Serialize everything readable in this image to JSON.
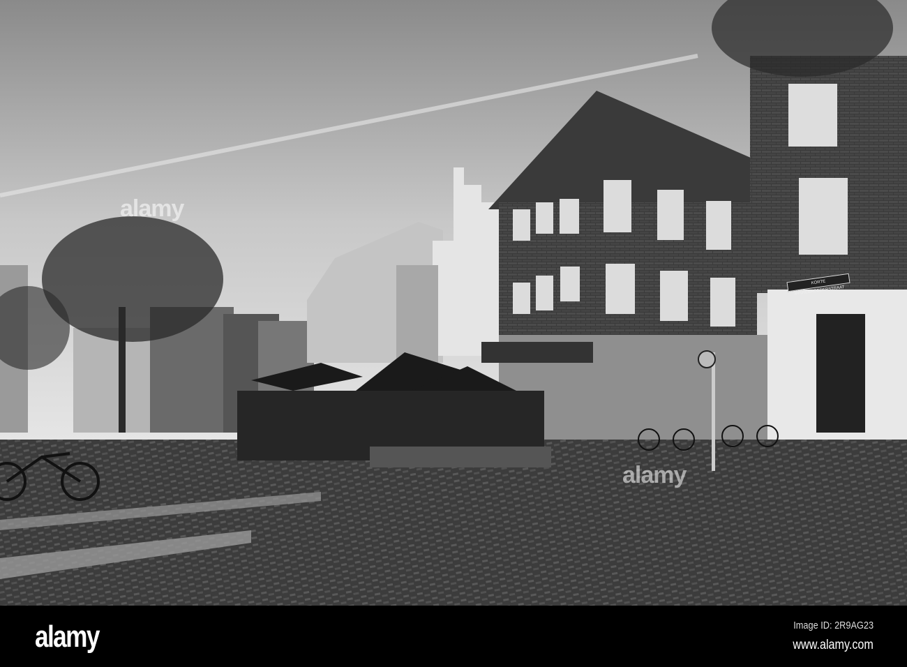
{
  "photo": {
    "street_sign": "KORTE MINREBROEDERSTRAAT",
    "watermark": "alamy"
  },
  "footer": {
    "logo": "alamy",
    "image_id": "Image ID: 2R9AG23",
    "url": "www.alamy.com"
  }
}
